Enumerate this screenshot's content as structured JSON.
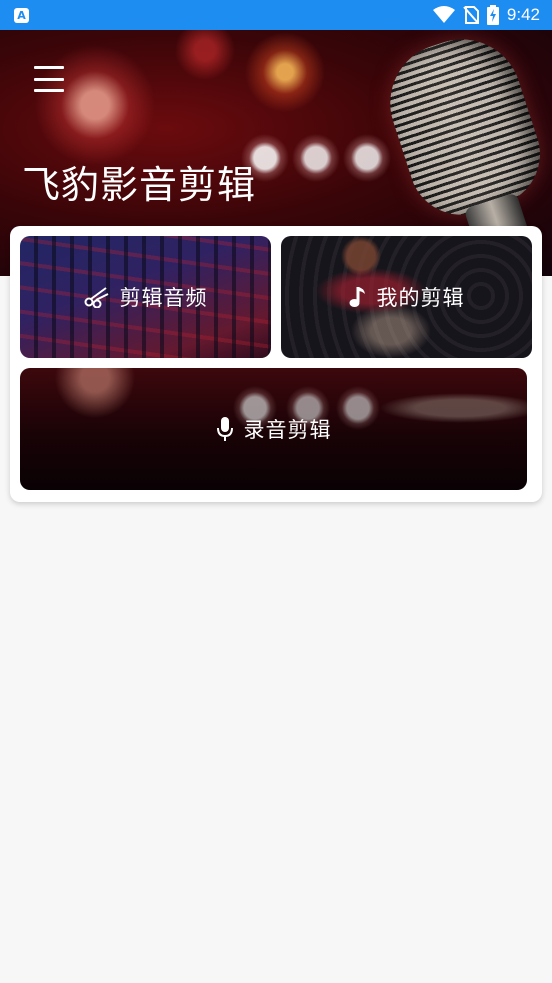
{
  "status_bar": {
    "app_badge": "A",
    "time": "9:42",
    "icons": [
      "wifi-icon",
      "no-sim-icon",
      "battery-charging-icon"
    ]
  },
  "header": {
    "title": "飞豹影音剪辑",
    "menu_icon": "menu-icon"
  },
  "tiles": [
    {
      "label": "剪辑音频",
      "icon": "scissors-icon"
    },
    {
      "label": "我的剪辑",
      "icon": "music-note-icon"
    },
    {
      "label": "录音剪辑",
      "icon": "microphone-icon"
    }
  ],
  "colors": {
    "status_bar": "#1e8df2",
    "background": "#f7f7f7",
    "card": "#ffffff"
  }
}
